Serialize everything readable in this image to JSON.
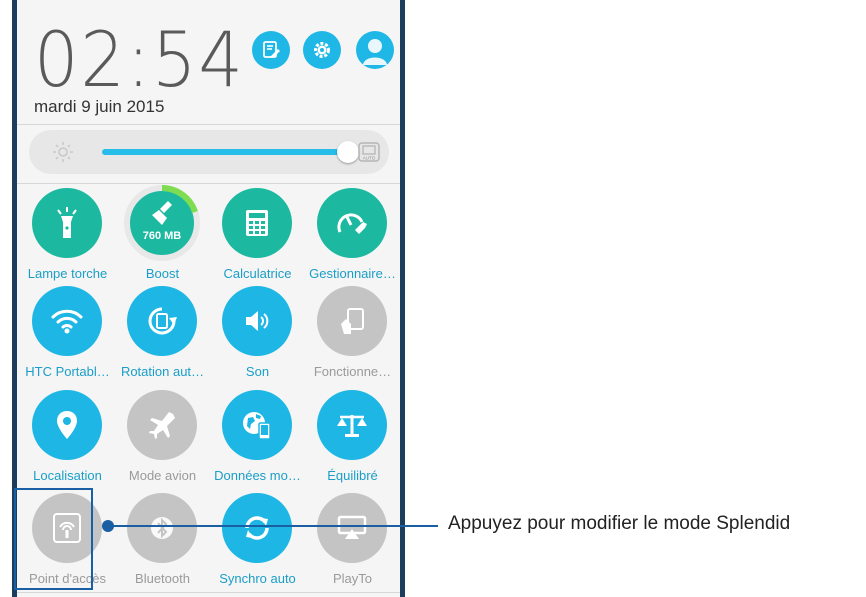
{
  "status": {
    "time": "02:54",
    "date": "mardi 9 juin 2015"
  },
  "top_buttons": [
    {
      "icon": "edit-note-icon"
    },
    {
      "icon": "gear-icon"
    },
    {
      "icon": "user-avatar-icon"
    }
  ],
  "brightness": {
    "level_percent": 95,
    "auto_label": "AUTO"
  },
  "tiles": [
    {
      "label": "Lampe torche",
      "icon": "flashlight-icon",
      "state": "on"
    },
    {
      "label": "Boost",
      "icon": "boost-broom-icon",
      "state": "on",
      "badge": "760 MB"
    },
    {
      "label": "Calculatrice",
      "icon": "calculator-icon",
      "state": "on"
    },
    {
      "label": "Gestionnaire…",
      "icon": "gauge-wrench-icon",
      "state": "on"
    },
    {
      "label": "HTC Portabl…",
      "icon": "wifi-icon",
      "state": "blue"
    },
    {
      "label": "Rotation aut…",
      "icon": "rotation-icon",
      "state": "blue"
    },
    {
      "label": "Son",
      "icon": "speaker-icon",
      "state": "blue"
    },
    {
      "label": "Fonctionne…",
      "icon": "glove-mode-icon",
      "state": "off"
    },
    {
      "label": "Localisation",
      "icon": "location-pin-icon",
      "state": "blue"
    },
    {
      "label": "Mode avion",
      "icon": "airplane-icon",
      "state": "off"
    },
    {
      "label": "Données mo…",
      "icon": "mobile-data-globe-icon",
      "state": "blue"
    },
    {
      "label": "Équilibré",
      "icon": "balance-scale-icon",
      "state": "blue"
    },
    {
      "label": "Point d'accès",
      "icon": "hotspot-icon",
      "state": "off"
    },
    {
      "label": "Bluetooth",
      "icon": "bluetooth-icon",
      "state": "off"
    },
    {
      "label": "Synchro auto",
      "icon": "sync-icon",
      "state": "blue"
    },
    {
      "label": "PlayTo",
      "icon": "playto-cast-icon",
      "state": "off"
    }
  ],
  "callout": {
    "text": "Appuyez pour modifier le mode Splendid"
  }
}
